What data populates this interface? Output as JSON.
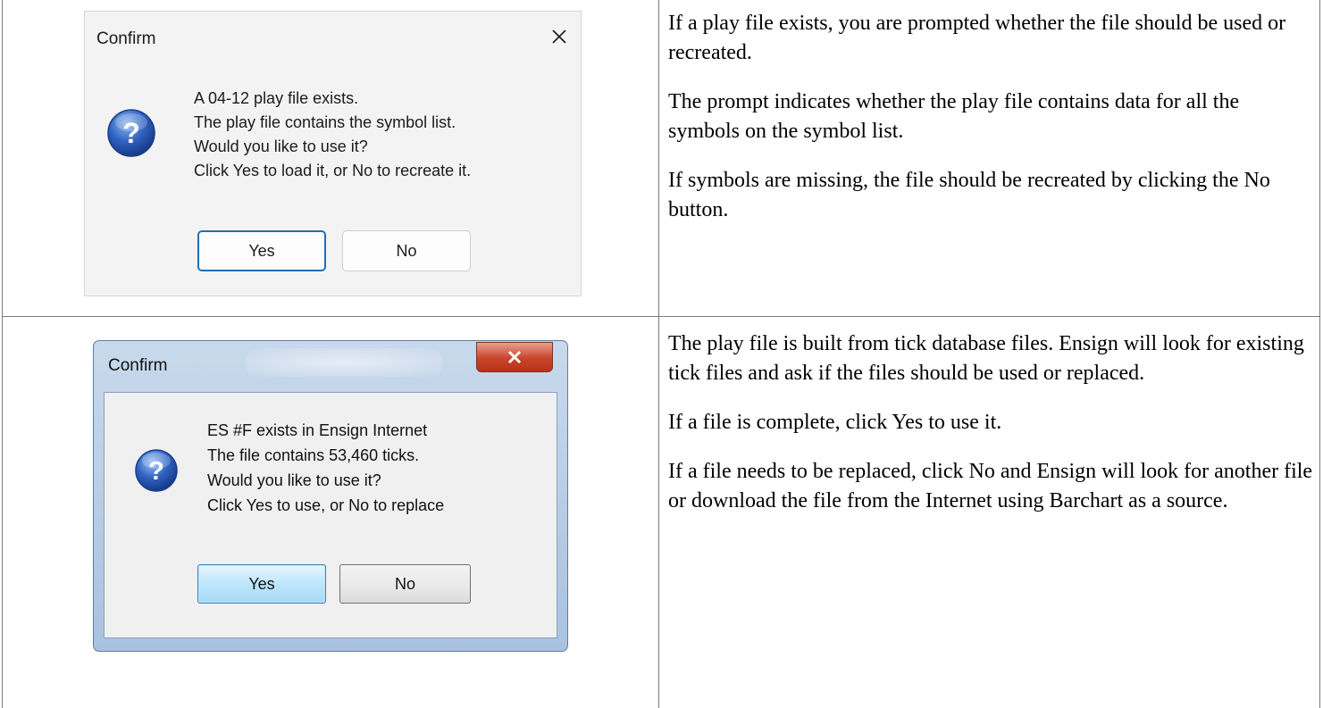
{
  "rows": [
    {
      "dialog": {
        "title": "Confirm",
        "close_glyph": "✕",
        "icon": "question-icon",
        "message_lines": [
          "A 04-12 play file exists.",
          "The play file contains the symbol list.",
          "Would you like to use it?",
          "Click Yes to load it, or No to recreate it."
        ],
        "yes_label": "Yes",
        "no_label": "No"
      },
      "paragraphs": [
        "If a play file exists, you are prompted whether the file should be used or recreated.",
        "The prompt indicates whether the play file contains data for all the symbols on the symbol list.",
        "If symbols are missing, the file should be recreated by clicking the  No  button."
      ]
    },
    {
      "dialog": {
        "title": "Confirm",
        "icon": "question-icon",
        "message_lines": [
          "ES #F exists in Ensign Internet",
          "The file contains 53,460 ticks.",
          "Would you like to use it?",
          "Click Yes to use, or No to replace"
        ],
        "yes_label": "Yes",
        "no_label": "No"
      },
      "paragraphs": [
        "The play file is built from tick database files. Ensign will look for existing tick files and ask if the files should be used or replaced.",
        "If a file is complete, click  Yes  to use it.",
        "If a file needs to be replaced, click  No  and Ensign will look for another file or download the file from the Internet using Barchart as a source."
      ]
    }
  ],
  "colors": {
    "table_border": "#7a7a7a",
    "win11_dialog_bg": "#f3f3f3",
    "win11_default_button_border": "#1f6fb8",
    "win7_frame": "#a9c2df",
    "win7_close_red": "#c8442a",
    "win7_default_button": "#bde6fd"
  }
}
